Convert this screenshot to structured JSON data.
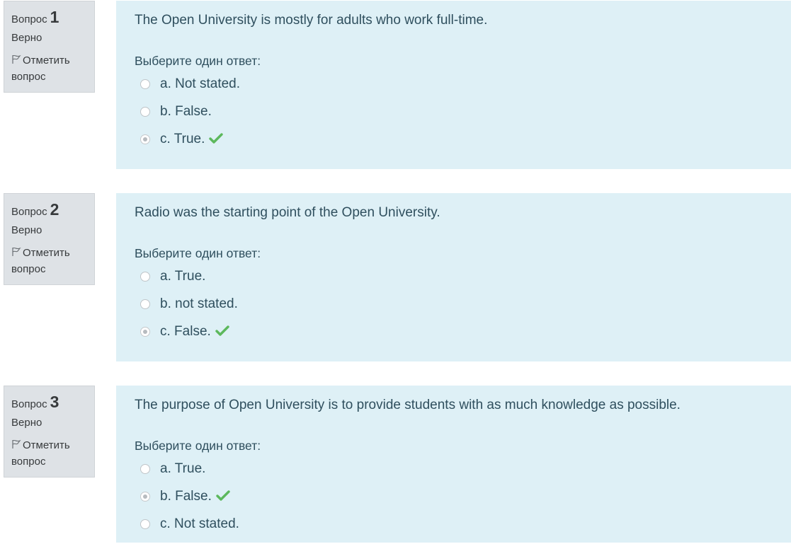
{
  "questions": [
    {
      "label": "Вопрос",
      "number": "1",
      "state": "Верно",
      "flag_label": "Отметить вопрос",
      "text": "The Open University is mostly for adults who work full-time.",
      "prompt": "Выберите один ответ:",
      "answers": [
        {
          "text": "a. Not stated.",
          "checked": false,
          "correct": false
        },
        {
          "text": "b. False.",
          "checked": false,
          "correct": false
        },
        {
          "text": "c. True.",
          "checked": true,
          "correct": true
        }
      ]
    },
    {
      "label": "Вопрос",
      "number": "2",
      "state": "Верно",
      "flag_label": "Отметить вопрос",
      "text": "Radio was the starting point of the  Open University.",
      "prompt": "Выберите один ответ:",
      "answers": [
        {
          "text": "a. True.",
          "checked": false,
          "correct": false
        },
        {
          "text": "b. not stated.",
          "checked": false,
          "correct": false
        },
        {
          "text": "c. False.",
          "checked": true,
          "correct": true
        }
      ]
    },
    {
      "label": "Вопрос",
      "number": "3",
      "state": "Верно",
      "flag_label": "Отметить вопрос",
      "text": "The purpose of Open University is to provide students with as much knowledge as possible.",
      "prompt": "Выберите один ответ:",
      "answers": [
        {
          "text": "a. True.",
          "checked": false,
          "correct": false
        },
        {
          "text": "b. False.",
          "checked": true,
          "correct": true
        },
        {
          "text": "c. Not stated.",
          "checked": false,
          "correct": false
        }
      ]
    }
  ],
  "icons": {
    "flag": "flag-icon",
    "check": "check-icon"
  },
  "colors": {
    "info_bg": "#dee2e6",
    "content_bg": "#def0f6",
    "correct": "#5cb85c",
    "text": "#2f4f5e"
  }
}
